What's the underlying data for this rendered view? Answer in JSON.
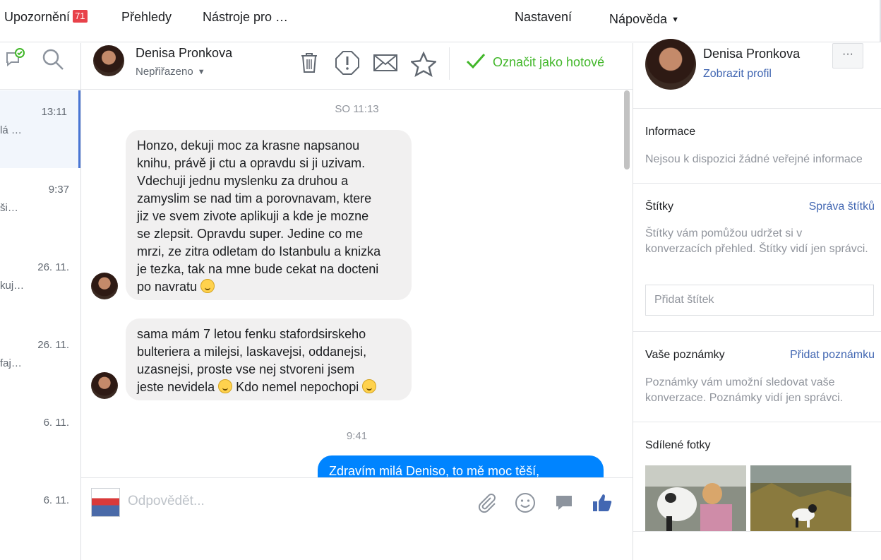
{
  "topnav": {
    "notifications_label": "Upozornění",
    "notifications_count": "71",
    "overviews_label": "Přehledy",
    "tools_label": "Nástroje pro …",
    "settings_label": "Nastavení",
    "help_label": "Nápověda"
  },
  "conversations": [
    {
      "time": "13:11",
      "snippet": "lá …"
    },
    {
      "time": "9:37",
      "snippet": "ši…"
    },
    {
      "time": "26. 11.",
      "snippet": "kuj…"
    },
    {
      "time": "26. 11.",
      "snippet": "faj…"
    },
    {
      "time": "6. 11.",
      "snippet": ""
    },
    {
      "time": "6. 11.",
      "snippet": ""
    }
  ],
  "header": {
    "name": "Denisa Pronkova",
    "assigned": "Nepřiřazeno",
    "done_label": "Označit jako hotové"
  },
  "messages": {
    "ts1": "SO 11:13",
    "m1_l1": "Honzo, dekuji moc za krasne napsanou",
    "m1_l2": "knihu, právě ji ctu a opravdu si ji uzivam.",
    "m1_l3": "Vdechuji jednu myslenku za druhou a",
    "m1_l4": "zamyslim se nad tim a porovnavam, ktere",
    "m1_l5": "jiz ve svem zivote aplikuji a kde je mozne",
    "m1_l6": "se zlepsit. Opravdu super. Jedine co me",
    "m1_l7": "mrzi, ze zitra odletam do Istanbulu a knizka",
    "m1_l8": "je tezka, tak na mne bude cekat na docteni",
    "m1_l9": "po navratu",
    "m2_l1": "sama mám 7 letou fenku stafordsirskeho",
    "m2_l2": "bulteriera a milejsi, laskavejsi, oddanejsi,",
    "m2_l3": "uzasnejsi, proste vse nej stvoreni jsem",
    "m2_l4a": "jeste nevidela",
    "m2_l4b": "Kdo nemel nepochopi",
    "ts2": "9:41",
    "m3": "Zdravím milá Deniso, to mě moc těší,"
  },
  "composer": {
    "placeholder": "Odpovědět..."
  },
  "profile": {
    "name": "Denisa Pronkova",
    "view_profile": "Zobrazit profil",
    "more": "···",
    "info_title": "Informace",
    "info_text": "Nejsou k dispozici žádné veřejné informace",
    "tags_title": "Štítky",
    "tags_manage": "Správa štítků",
    "tags_text": "Štítky vám pomůžou udržet si v konverzacích přehled. Štítky vidí jen správci.",
    "tag_input_placeholder": "Přidat štítek",
    "notes_title": "Vaše poznámky",
    "notes_add": "Přidat poznámku",
    "notes_text": "Poznámky vám umožní sledovat vaše konverzace. Poznámky vidí jen správci.",
    "photos_title": "Sdílené fotky"
  },
  "colors": {
    "accent": "#4267b2",
    "done_green": "#42b72a",
    "my_bubble": "#0084ff",
    "badge": "#e8424a"
  }
}
